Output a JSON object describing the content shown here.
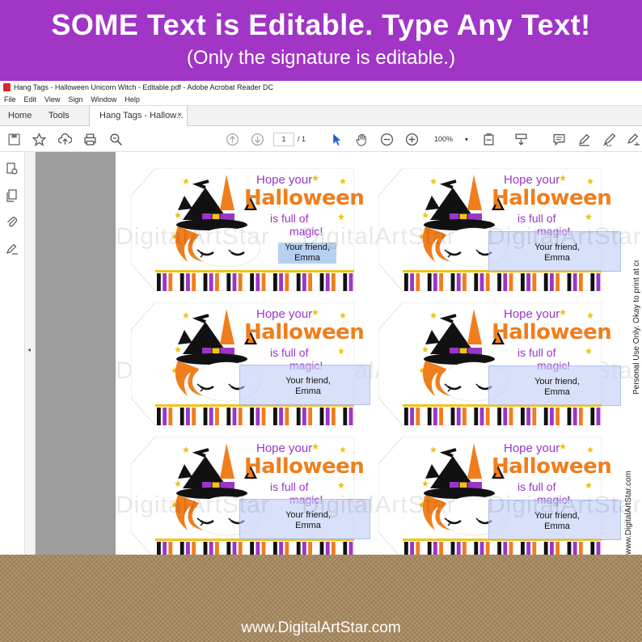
{
  "banner": {
    "title": "SOME Text is Editable.  Type Any Text!",
    "subtitle": "(Only the signature is editable.)",
    "background": "#a035c6"
  },
  "window": {
    "title": "Hang Tags - Halloween Unicorn Witch - Editable.pdf - Adobe Acrobat Reader DC",
    "menu": [
      "File",
      "Edit",
      "View",
      "Sign",
      "Window",
      "Help"
    ],
    "tabs": {
      "home": "Home",
      "tools": "Tools",
      "document": "Hang Tags - Hallow...",
      "close": "×"
    }
  },
  "toolbar": {
    "icons": [
      "save-icon",
      "bookmark-star-icon",
      "upload-cloud-icon",
      "print-icon",
      "zoom-search-icon",
      "page-up-icon",
      "page-down-icon",
      "select-cursor-icon",
      "hand-icon",
      "zoom-out-icon",
      "zoom-in-icon",
      "fit-page-icon",
      "scroll-mode-icon",
      "comment-icon",
      "highlight-pen-icon",
      "sign-icon",
      "fill-sign-icon"
    ],
    "page_current": "1",
    "page_total": "/ 1",
    "zoom": "100%",
    "accent": "#1d5fd1"
  },
  "leftnav": {
    "icons": [
      "page-thumbnails-icon",
      "copy-pages-icon",
      "attachment-icon",
      "signature-panel-icon"
    ],
    "collapse": "◂"
  },
  "page": {
    "watermark": "DigitalArtStar",
    "side_text_1": "www.DigitalArtStar.com",
    "side_text_2": "Personal Use Only.  Okay to print at copy center."
  },
  "tags": [
    {
      "hope": "Hope your",
      "halloween": "Halloween",
      "full": "is full of",
      "magic": "magic!",
      "field_line1": "Your friend,",
      "field_line2": "Emma",
      "field_state": "selected"
    },
    {
      "hope": "Hope your",
      "halloween": "Halloween",
      "full": "is full of",
      "magic": "magic!",
      "field_line1": "Your friend,",
      "field_line2": "Emma",
      "field_state": "highlight"
    },
    {
      "hope": "Hope your",
      "halloween": "Halloween",
      "full": "is full of",
      "magic": "magic!",
      "field_line1": "Your friend,",
      "field_line2": "Emma",
      "field_state": "highlight"
    },
    {
      "hope": "Hope your",
      "halloween": "Halloween",
      "full": "is full of",
      "magic": "magic!",
      "field_line1": "Your friend,",
      "field_line2": "Emma",
      "field_state": "highlight"
    },
    {
      "hope": "Hope your",
      "halloween": "Halloween",
      "full": "is full of",
      "magic": "magic!",
      "field_line1": "Your friend,",
      "field_line2": "Emma",
      "field_state": "highlight"
    },
    {
      "hope": "Hope your",
      "halloween": "Halloween",
      "full": "is full of",
      "magic": "magic!",
      "field_line1": "Your friend,",
      "field_line2": "Emma",
      "field_state": "highlight"
    }
  ],
  "colors": {
    "orange": "#f07e1c",
    "purple": "#9b36c8",
    "black": "#111111",
    "gold": "#f0c419",
    "white": "#ffffff"
  },
  "footer": {
    "url": "www.DigitalArtStar.com"
  }
}
